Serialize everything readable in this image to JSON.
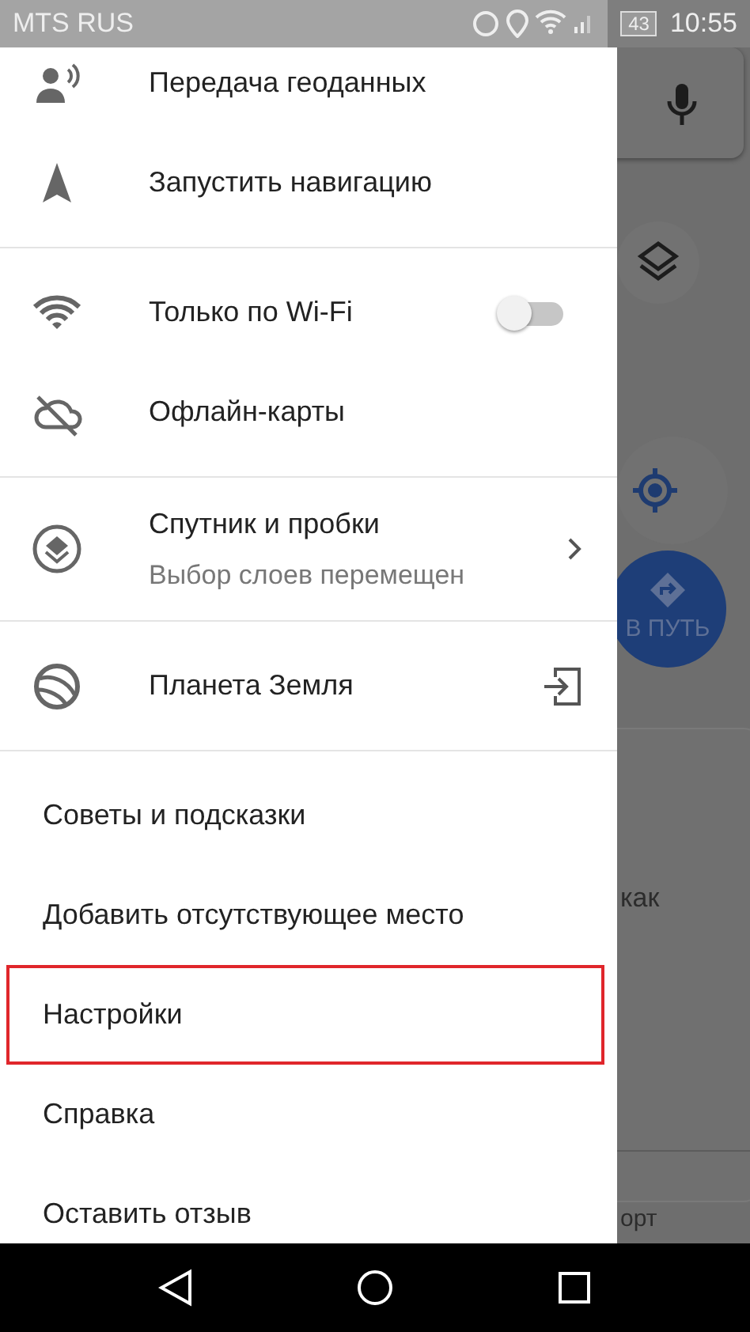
{
  "status_bar": {
    "carrier": "MTS RUS",
    "battery": "43",
    "time": "10:55"
  },
  "drawer": {
    "sections": [
      {
        "items": [
          {
            "label": "Передача геоданных",
            "kind": "icon"
          },
          {
            "label": "Запустить навигацию",
            "kind": "icon"
          }
        ]
      },
      {
        "items": [
          {
            "label": "Только по Wi-Fi",
            "kind": "toggle",
            "on": false
          },
          {
            "label": "Офлайн-карты",
            "kind": "icon"
          }
        ]
      },
      {
        "items": [
          {
            "label": "Спутник и пробки",
            "sublabel": "Выбор слоев перемещен",
            "kind": "submenu"
          }
        ]
      },
      {
        "items": [
          {
            "label": "Планета Земля",
            "kind": "launch"
          }
        ]
      },
      {
        "items": [
          {
            "label": "Советы и подсказки",
            "highlighted": false
          },
          {
            "label": "Добавить отсутствующее место",
            "highlighted": false
          },
          {
            "label": "Настройки",
            "highlighted": true
          },
          {
            "label": "Справка",
            "highlighted": false
          },
          {
            "label": "Оставить отзыв",
            "highlighted": false
          }
        ]
      }
    ]
  },
  "map": {
    "directions_button": "В ПУТЬ",
    "card_text": "как",
    "bottom_text": "орт"
  }
}
